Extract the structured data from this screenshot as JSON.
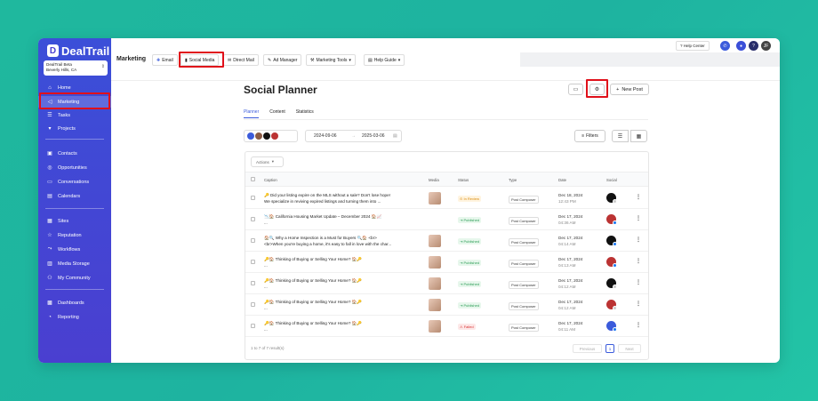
{
  "app": {
    "brand": "DealTrail"
  },
  "account": {
    "name": "DealTrail Beta",
    "location": "Beverly Hills, CA"
  },
  "sidebar": {
    "items": [
      {
        "label": "Home",
        "icon": "home-icon"
      },
      {
        "label": "Marketing",
        "icon": "megaphone-icon"
      },
      {
        "label": "Tasks",
        "icon": "list-icon"
      },
      {
        "label": "Projects",
        "icon": "projects-icon"
      },
      {
        "label": "Contacts",
        "icon": "contacts-icon"
      },
      {
        "label": "Opportunities",
        "icon": "opportunities-icon"
      },
      {
        "label": "Conversations",
        "icon": "chat-icon"
      },
      {
        "label": "Calendars",
        "icon": "calendar-icon"
      },
      {
        "label": "Sites",
        "icon": "sites-icon"
      },
      {
        "label": "Reputation",
        "icon": "star-icon"
      },
      {
        "label": "Workflows",
        "icon": "workflow-icon"
      },
      {
        "label": "Media Storage",
        "icon": "folder-icon"
      },
      {
        "label": "My Community",
        "icon": "community-icon"
      },
      {
        "label": "Dashboards",
        "icon": "dashboard-icon"
      },
      {
        "label": "Reporting",
        "icon": "reporting-icon"
      }
    ]
  },
  "topbar": {
    "title": "Marketing",
    "tabs": [
      "Email",
      "Social Media",
      "Direct Mail",
      "Ad Manager",
      "Marketing Tools",
      "Help Guide"
    ],
    "help_center": "? Help Center"
  },
  "page": {
    "title": "Social Planner",
    "new_post": "New Post",
    "tabs": [
      "Planner",
      "Content",
      "Statistics"
    ],
    "date_from": "2024-09-06",
    "date_to": "2025-03-06",
    "filters": "Filters",
    "actions": "Actions"
  },
  "table": {
    "headers": [
      "Caption",
      "Media",
      "Status",
      "Type",
      "Date",
      "Social"
    ],
    "rows": [
      {
        "cap1": "🔑 Did your listing expire on the MLS without a sale? Don't lose hope!",
        "cap2": "We specialize in reviving expired listings and turning them into ...",
        "status": "In Review",
        "type": "Post Composer",
        "date": "Dec 18, 2024",
        "time": "12:43 PM"
      },
      {
        "cap1": "📉🏠 California Housing Market Update – December 2024 🏠📈",
        "cap2": "...",
        "status": "Published",
        "type": "Post Composer",
        "date": "Dec 17, 2024",
        "time": "04:36 AM"
      },
      {
        "cap1": "🏠🔍 Why a Home Inspection is a Must for Buyers 🔍🏠 <br>",
        "cap2": "<br>When you're buying a home, it's easy to fall in love with the char...",
        "status": "Published",
        "type": "Post Composer",
        "date": "Dec 17, 2024",
        "time": "04:14 AM"
      },
      {
        "cap1": "🔑🏠 Thinking of Buying or Selling Your Home? 🏠🔑",
        "cap2": "...",
        "status": "Published",
        "type": "Post Composer",
        "date": "Dec 17, 2024",
        "time": "04:13 AM"
      },
      {
        "cap1": "🔑🏠 Thinking of Buying or Selling Your Home? 🏠🔑",
        "cap2": "...",
        "status": "Published",
        "type": "Post Composer",
        "date": "Dec 17, 2024",
        "time": "04:12 AM"
      },
      {
        "cap1": "🔑🏠 Thinking of Buying or Selling Your Home? 🏠🔑",
        "cap2": "...",
        "status": "Published",
        "type": "Post Composer",
        "date": "Dec 17, 2024",
        "time": "04:12 AM"
      },
      {
        "cap1": "🔑🏠 Thinking of Buying or Selling Your Home? 🏠🔑",
        "cap2": "...",
        "status": "Failed",
        "type": "Post Composer",
        "date": "Dec 17, 2024",
        "time": "04:11 AM"
      }
    ],
    "footer": "1 to 7 of 7 result(s)",
    "previous": "Previous",
    "page": "1",
    "next": "Next"
  },
  "colors": {
    "accent": "#3b4fd8",
    "highlight": "#e0101a"
  }
}
